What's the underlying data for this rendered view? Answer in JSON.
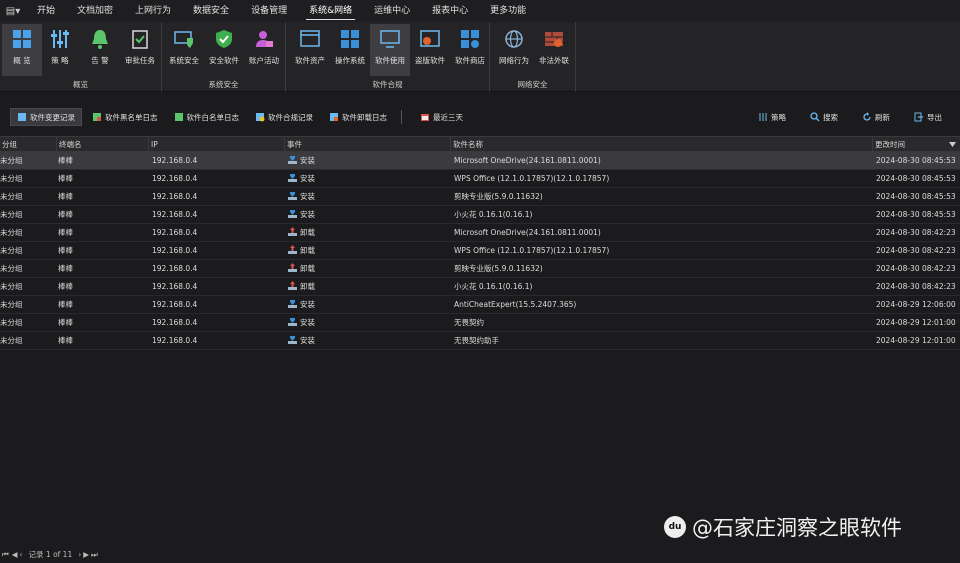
{
  "menu": {
    "tabs": [
      "开始",
      "文档加密",
      "上网行为",
      "数据安全",
      "设备管理",
      "系统&网络",
      "运维中心",
      "报表中心",
      "更多功能"
    ],
    "active_index": 5
  },
  "ribbon": {
    "groups": [
      {
        "label": "概览",
        "buttons": [
          "概 览",
          "策 略",
          "告 警",
          "审批任务"
        ]
      },
      {
        "label": "系统安全",
        "buttons": [
          "系统安全",
          "安全软件",
          "账户活动"
        ]
      },
      {
        "label": "软件合规",
        "buttons": [
          "软件资产",
          "操作系统",
          "软件使用",
          "盗版软件",
          "软件商店"
        ]
      },
      {
        "label": "网络安全",
        "buttons": [
          "网络行为",
          "非法外联"
        ]
      }
    ]
  },
  "subbar": {
    "tabs": [
      "软件变更记录",
      "软件黑名单日志",
      "软件白名单日志",
      "软件合规记录",
      "软件卸载日志"
    ],
    "date_filter": "最近三天",
    "actions": [
      "策略",
      "搜索",
      "刷新",
      "导出"
    ]
  },
  "table": {
    "columns": [
      "分组",
      "终端名",
      "IP",
      "事件",
      "软件名称",
      "更改时间"
    ],
    "rows": [
      {
        "group": "未分组",
        "terminal": "棒棒",
        "ip": "192.168.0.4",
        "event": "安装",
        "software": "Microsoft OneDrive(24.161.0811.0001)",
        "time": "2024-08-30 08:45:53"
      },
      {
        "group": "未分组",
        "terminal": "棒棒",
        "ip": "192.168.0.4",
        "event": "安装",
        "software": "WPS Office (12.1.0.17857)(12.1.0.17857)",
        "time": "2024-08-30 08:45:53"
      },
      {
        "group": "未分组",
        "terminal": "棒棒",
        "ip": "192.168.0.4",
        "event": "安装",
        "software": "剪映专业版(5.9.0.11632)",
        "time": "2024-08-30 08:45:53"
      },
      {
        "group": "未分组",
        "terminal": "棒棒",
        "ip": "192.168.0.4",
        "event": "安装",
        "software": "小火花 0.16.1(0.16.1)",
        "time": "2024-08-30 08:45:53"
      },
      {
        "group": "未分组",
        "terminal": "棒棒",
        "ip": "192.168.0.4",
        "event": "卸载",
        "software": "Microsoft OneDrive(24.161.0811.0001)",
        "time": "2024-08-30 08:42:23"
      },
      {
        "group": "未分组",
        "terminal": "棒棒",
        "ip": "192.168.0.4",
        "event": "卸载",
        "software": "WPS Office (12.1.0.17857)(12.1.0.17857)",
        "time": "2024-08-30 08:42:23"
      },
      {
        "group": "未分组",
        "terminal": "棒棒",
        "ip": "192.168.0.4",
        "event": "卸载",
        "software": "剪映专业版(5.9.0.11632)",
        "time": "2024-08-30 08:42:23"
      },
      {
        "group": "未分组",
        "terminal": "棒棒",
        "ip": "192.168.0.4",
        "event": "卸载",
        "software": "小火花 0.16.1(0.16.1)",
        "time": "2024-08-30 08:42:23"
      },
      {
        "group": "未分组",
        "terminal": "棒棒",
        "ip": "192.168.0.4",
        "event": "安装",
        "software": "AntiCheatExpert(15.5.2407.365)",
        "time": "2024-08-29 12:06:00"
      },
      {
        "group": "未分组",
        "terminal": "棒棒",
        "ip": "192.168.0.4",
        "event": "安装",
        "software": "无畏契约",
        "time": "2024-08-29 12:01:00"
      },
      {
        "group": "未分组",
        "terminal": "棒棒",
        "ip": "192.168.0.4",
        "event": "安装",
        "software": "无畏契约助手",
        "time": "2024-08-29 12:01:00"
      }
    ]
  },
  "footer": {
    "record_text": "记录 1 of 11"
  },
  "watermark": {
    "text": "@石家庄洞察之眼软件",
    "logo": "du"
  },
  "colors": {
    "install": "#3b8fd6",
    "uninstall": "#d9534f",
    "accent": "#3b8fd6"
  }
}
